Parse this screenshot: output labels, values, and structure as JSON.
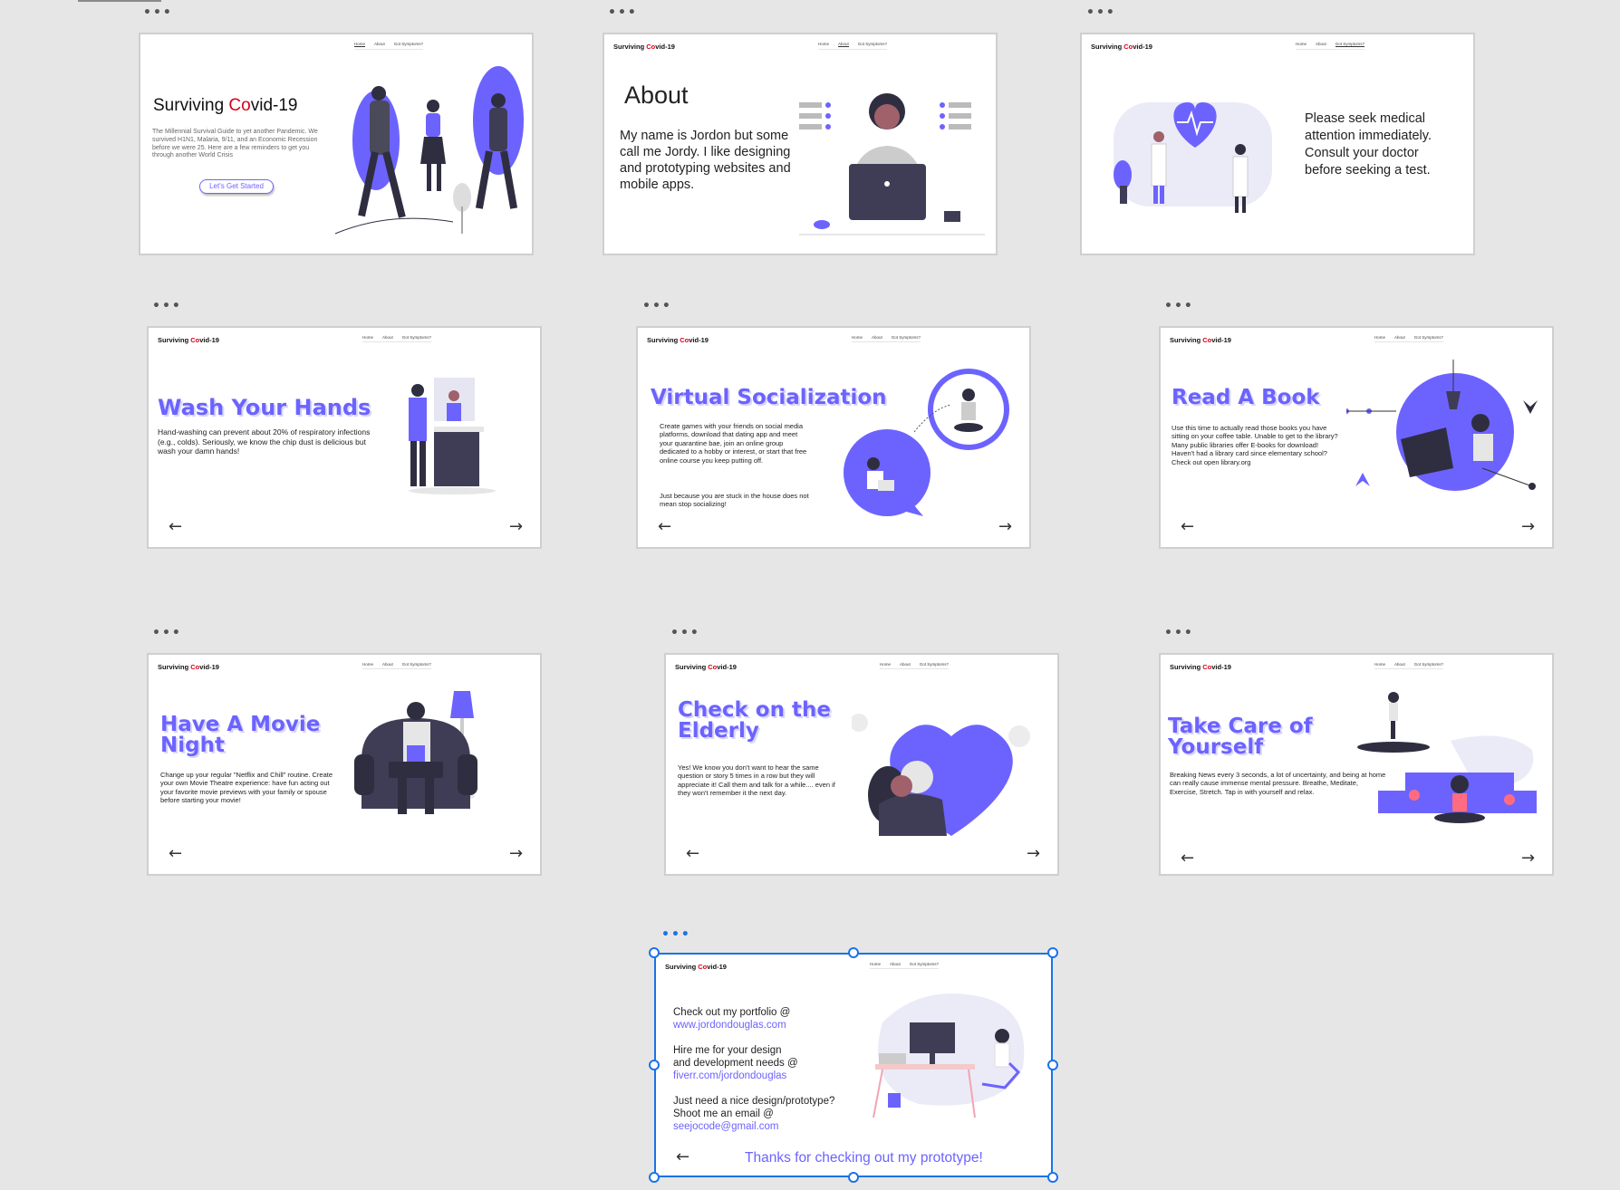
{
  "brand": {
    "prefix": "Surviving ",
    "co": "Co",
    "suffix": "vid-19"
  },
  "nav": [
    "Home",
    "About",
    "Got Symptoms?"
  ],
  "colors": {
    "accent": "#6c63ff",
    "brand_red": "#d6001c",
    "selection": "#1a73e8"
  },
  "artboards": {
    "home": {
      "title_prefix": "Surviving ",
      "title_co": "Co",
      "title_suffix": "vid-19",
      "text": "The Millennial Survival Guide to yet another Pandemic. We survived H1N1, Malaria, 9/11, and an Economic Recession before we were 25. Here are a few reminders to get you through another World Crisis",
      "button": "Let's Get Started"
    },
    "about": {
      "title": "About",
      "text": "My name is Jordon but some call me Jordy. I like designing and prototyping websites and mobile apps."
    },
    "symptoms": {
      "text": "Please seek medical attention immediately. Consult your doctor before seeking a test."
    },
    "wash": {
      "title": "Wash Your Hands",
      "text": "Hand-washing can prevent about 20% of respiratory infections (e.g., colds). Seriously, we know the chip dust is delicious but wash your damn hands!"
    },
    "social": {
      "title": "Virtual Socialization",
      "text1": "Create games with your friends on social media platforms, download that dating app and meet your quarantine bae, join an online group dedicated to a hobby or interest, or start that free online course you keep putting off.",
      "text2": "Just because you are stuck in the house does not mean stop socializing!"
    },
    "book": {
      "title": "Read A Book",
      "text": "Use this time to actually read those books you have sitting on your coffee table. Unable to get to the library? Many public libraries offer E-books for download! Haven't had a library card since elementary school? Check out open library.org"
    },
    "movie": {
      "title_l1": "Have A Movie",
      "title_l2": "Night",
      "text": "Change up your regular \"Netflix and Chill\" routine. Create your own Movie Theatre experience: have fun acting out your favorite movie previews with your family or spouse before starting your movie!"
    },
    "elderly": {
      "title_l1": "Check on the",
      "title_l2": "Elderly",
      "text": "Yes! We know you don't want to hear the same question or story 5 times in a row but they will appreciate it! Call them and talk for a while.... even if they won't remember it the next day."
    },
    "selfcare": {
      "title_l1": "Take Care of",
      "title_l2": "Yourself",
      "text": "Breaking News every 3 seconds, a lot of uncertainty, and being at home can really cause immense mental pressure. Breathe, Meditate, Exercise, Stretch. Tap in with yourself and relax."
    },
    "contact": {
      "portfolio_l1": "Check out my portfolio @",
      "portfolio_link": "www.jordondouglas.com",
      "hire_l1": "Hire me for your design",
      "hire_l2": "and development needs @",
      "hire_link": "fiverr.com/jordondouglas",
      "email_l1": "Just need a nice design/prototype?",
      "email_l2": "Shoot me an email @",
      "email_link": "seejocode@gmail.com",
      "thanks": "Thanks for checking out my prototype!"
    }
  },
  "icons": {
    "more": "more-dots-icon",
    "prev": "arrow-left-icon",
    "next": "arrow-right-icon"
  },
  "glyphs": {
    "dots": "•••",
    "prev": "←",
    "next": "→"
  }
}
